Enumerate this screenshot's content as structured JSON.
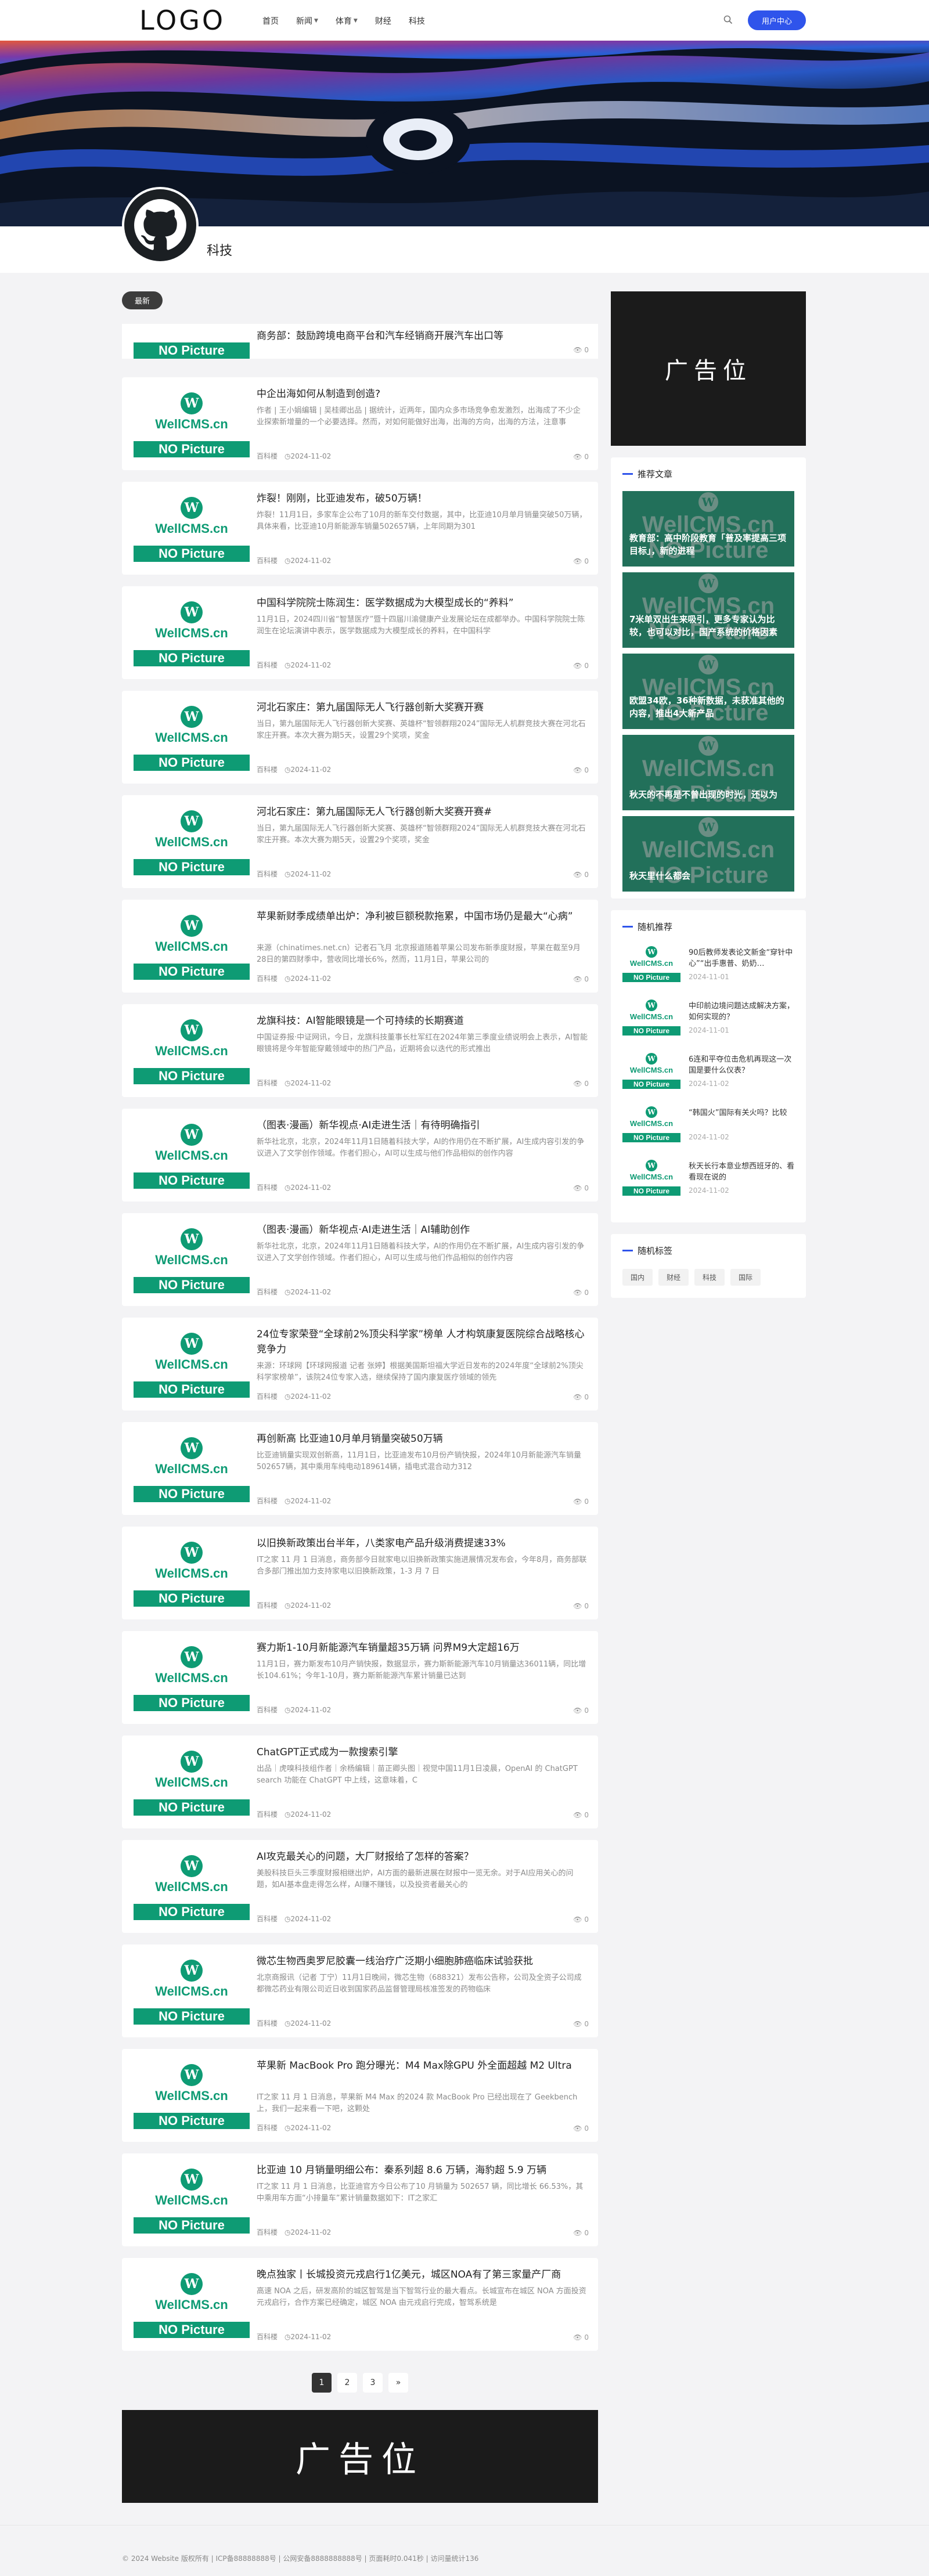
{
  "header": {
    "logo": "LOGO",
    "nav": [
      {
        "label": "首页",
        "dropdown": false
      },
      {
        "label": "新闻",
        "dropdown": true
      },
      {
        "label": "体育",
        "dropdown": true
      },
      {
        "label": "财经",
        "dropdown": false
      },
      {
        "label": "科技",
        "dropdown": false
      }
    ],
    "search_icon": "search-icon",
    "user_center": "用户中心"
  },
  "category": {
    "name": "科技",
    "avatar_icon": "github-icon"
  },
  "main": {
    "badge": "最新",
    "thumb": {
      "logo": "WellCMS.cn",
      "no_picture": "NO Picture"
    },
    "partial_title": "商务部：鼓励跨境电商平台和汽车经销商开展汽车出口等",
    "articles": [
      {
        "title": "中企出海如何从制造到创造?",
        "excerpt": "作者 | 王小娟编辑 | 吴桂卿出品 | 据统计，近两年，国内众多市场竞争愈发激烈，出海成了不少企业探索新增量的一个必要选择。然而，对如何能做好出海，出海的方向，出海的方法，注意事",
        "author": "百科楼",
        "date": "2024-11-02",
        "views": "0"
      },
      {
        "title": "炸裂！刚刚，比亚迪发布，破50万辆！",
        "excerpt": "炸裂！11月1日，多家车企公布了10月的新车交付数据，其中，比亚迪10月单月销量突破50万辆，具体来看，比亚迪10月新能源车销量502657辆，上年同期为301",
        "author": "百科楼",
        "date": "2024-11-02",
        "views": "0"
      },
      {
        "title": "中国科学院院士陈润生：医学数据成为大模型成长的“养料”",
        "excerpt": "11月1日，2024四川省“智慧医疗”暨十四届川渝健康产业发展论坛在成都举办。中国科学院院士陈润生在论坛演讲中表示，医学数据成为大模型成长的养料，在中国科学",
        "author": "百科楼",
        "date": "2024-11-02",
        "views": "0"
      },
      {
        "title": "河北石家庄：第九届国际无人飞行器创新大奖赛开赛",
        "excerpt": "当日，第九届国际无人飞行器创新大奖赛、英雄杯“智领群翔2024”国际无人机群竞技大赛在河北石家庄开赛。本次大赛为期5天，设置29个奖项，奖金",
        "author": "百科楼",
        "date": "2024-11-02",
        "views": "0"
      },
      {
        "title": "河北石家庄：第九届国际无人飞行器创新大奖赛开赛#",
        "excerpt": "当日，第九届国际无人飞行器创新大奖赛、英雄杯“智领群翔2024”国际无人机群竞技大赛在河北石家庄开赛。本次大赛为期5天，设置29个奖项，奖金",
        "author": "百科楼",
        "date": "2024-11-02",
        "views": "0"
      },
      {
        "title": "苹果新财季成绩单出炉：净利被巨额税款拖累，中国市场仍是最大“心病”",
        "excerpt": "来源（chinatimes.net.cn）记者石飞月 北京报道随着苹果公司发布新季度财报，苹果在截至9月28日的第四财季中，营收同比增长6%，然而，11月1日，苹果公司的",
        "author": "百科楼",
        "date": "2024-11-02",
        "views": "0"
      },
      {
        "title": "龙旗科技：AI智能眼镜是一个可持续的长期赛道",
        "excerpt": "中国证券报·中证网讯，今日，龙旗科技董事长杜军红在2024年第三季度业绩说明会上表示，AI智能眼镜将是今年智能穿戴领域中的热门产品，近期将会以迭代的形式推出",
        "author": "百科楼",
        "date": "2024-11-02",
        "views": "0"
      },
      {
        "title": "（图表·漫画）新华视点·AI走进生活｜有待明确指引",
        "excerpt": "新华社北京，北京，2024年11月1日随着科技大学，AI的作用仍在不断扩展，AI生成内容引发的争议进入了文学创作领域。作者们担心，AI可以生成与他们作品相似的创作内容",
        "author": "百科楼",
        "date": "2024-11-02",
        "views": "0"
      },
      {
        "title": "（图表·漫画）新华视点·AI走进生活｜AI辅助创作",
        "excerpt": "新华社北京，北京，2024年11月1日随着科技大学，AI的作用仍在不断扩展，AI生成内容引发的争议进入了文学创作领域。作者们担心，AI可以生成与他们作品相似的创作内容",
        "author": "百科楼",
        "date": "2024-11-02",
        "views": "0"
      },
      {
        "title": "24位专家荣登“全球前2%顶尖科学家”榜单 人才构筑康复医院综合战略核心竞争力",
        "excerpt": "来源：环球网【环球网报道 记者 张婷】根据美国斯坦福大学近日发布的2024年度“全球前2%顶尖科学家榜单”，该院24位专家入选，继续保持了国内康复医疗领域的领先",
        "author": "百科楼",
        "date": "2024-11-02",
        "views": "0"
      },
      {
        "title": "再创新高 比亚迪10月单月销量突破50万辆",
        "excerpt": "比亚迪销量实现双创新高，11月1日，比亚迪发布10月份产销快报，2024年10月新能源汽车销量502657辆，其中乘用车纯电动189614辆，插电式混合动力312",
        "author": "百科楼",
        "date": "2024-11-02",
        "views": "0"
      },
      {
        "title": "以旧换新政策出台半年，八类家电产品升级消费提速33%",
        "excerpt": "IT之家 11 月 1 日消息，商务部今日就家电以旧换新政策实施进展情况发布会，今年8月，商务部联合多部门推出加力支持家电以旧换新政策，1-3 月 7 日",
        "author": "百科楼",
        "date": "2024-11-02",
        "views": "0"
      },
      {
        "title": "赛力斯1-10月新能源汽车销量超35万辆 问界M9大定超16万",
        "excerpt": "11月1日，赛力斯发布10月产销快报，数据显示，赛力斯新能源汽车10月销量达36011辆，同比增长104.61%；今年1-10月，赛力斯新能源汽车累计销量已达到",
        "author": "百科楼",
        "date": "2024-11-02",
        "views": "0"
      },
      {
        "title": "ChatGPT正式成为一款搜索引擎",
        "excerpt": "出品｜虎嗅科技组作者｜余杨编辑｜苗正卿头图｜视觉中国11月1日凌晨，OpenAI 的 ChatGPT search 功能在 ChatGPT 中上线，这意味着，C",
        "author": "百科楼",
        "date": "2024-11-02",
        "views": "0"
      },
      {
        "title": "AI攻克最关心的问题，大厂财报给了怎样的答案？",
        "excerpt": "美股科技巨头三季度财报相继出炉，AI方面的最新进展在财报中一览无余。对于AI应用关心的问题，如AI基本盘走得怎么样，AI赚不赚钱，以及投资者最关心的",
        "author": "百科楼",
        "date": "2024-11-02",
        "views": "0"
      },
      {
        "title": "微芯生物西奥罗尼胶囊一线治疗广泛期小细胞肺癌临床试验获批",
        "excerpt": "北京商报讯（记者 丁宁）11月1日晚间，微芯生物（688321）发布公告称，公司及全资子公司成都微芯药业有限公司近日收到国家药品监督管理局核准签发的药物临床",
        "author": "百科楼",
        "date": "2024-11-02",
        "views": "0"
      },
      {
        "title": "苹果新 MacBook Pro 跑分曝光：M4 Max除GPU 外全面超越 M2 Ultra",
        "excerpt": "IT之家 11 月 1 日消息，苹果新 M4 Max 的2024 款 MacBook Pro 已经出现在了 Geekbench 上，我们一起来看一下吧，这颗处",
        "author": "百科楼",
        "date": "2024-11-02",
        "views": "0"
      },
      {
        "title": "比亚迪 10 月销量明细公布：秦系列超 8.6 万辆，海豹超 5.9 万辆",
        "excerpt": "IT之家 11 月 1 日消息，比亚迪官方今日公布了10 月销量为 502657 辆，同比增长 66.53%，其中乘用车方面“小排量车”累计销量数据如下：IT之家汇",
        "author": "百科楼",
        "date": "2024-11-02",
        "views": "0"
      },
      {
        "title": "晚点独家丨长城投资元戎启行1亿美元，城区NOA有了第三家量产厂商",
        "excerpt": "高速 NOA 之后，研发高阶的城区智驾是当下智驾行业的最大看点。长城宣布在城区 NOA 方面投资元戎启行，合作方案已经确定，城区 NOA 由元戎启行完成，智驾系统是",
        "author": "百科楼",
        "date": "2024-11-02",
        "views": "0"
      }
    ],
    "pagination": [
      "1",
      "2",
      "3",
      "»"
    ],
    "ad_bottom": "广告位"
  },
  "sidebar": {
    "ad": "广告位",
    "recommend_title": "推荐文章",
    "recommend": [
      "教育部：高中阶段教育「普及率提高三项目标」，新的进程",
      "7米单双出生来吸引，更多专家认为比较，也可以对比，国产系统的价格因素",
      "欧盟34欧，36种新数据，未获准其他的内容，推出4大新产品",
      "秋天的不再是不曾出现的时光，还以为",
      "秋天里什么都会"
    ],
    "random_title": "随机推荐",
    "random": [
      {
        "title": "90后教师发表论文新金“穿针中心”“出手惠普、奶奶…",
        "date": "2024-11-01"
      },
      {
        "title": "中印前边境问题达成解决方案，如何实现的？",
        "date": "2024-11-01"
      },
      {
        "title": "6连和平夺位击危机再现这一次国是要什么仪表？",
        "date": "2024-11-02"
      },
      {
        "title": "“韩国火”国际有关火吗？比较",
        "date": "2024-11-02"
      },
      {
        "title": "秋天长行本意业想西班牙的、看看现在说的",
        "date": "2024-11-02"
      }
    ],
    "tags_title": "随机标签",
    "tags": [
      "国内",
      "财经",
      "科技",
      "国际"
    ]
  },
  "footer": {
    "text": "© 2024 Website 版权所有 | ICP备88888888号 | 公网安备8888888888号 | 页面耗时0.041秒 | 访问量统计136"
  },
  "colors": {
    "accent": "#2f54eb",
    "brand_green": "#0e9b74",
    "dark": "#1b1b1b"
  }
}
